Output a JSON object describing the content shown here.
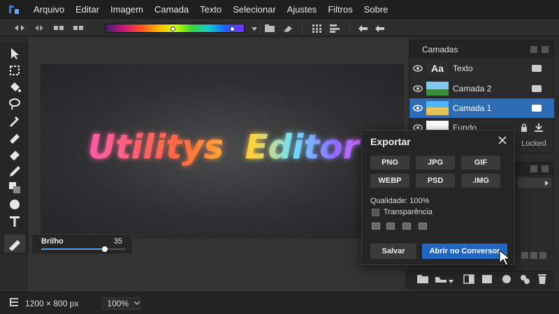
{
  "menu": {
    "items": [
      "Arquivo",
      "Editar",
      "Imagem",
      "Camada",
      "Texto",
      "Selecionar",
      "Ajustes",
      "Filtros",
      "Sobre"
    ]
  },
  "canvas": {
    "title_text_1": "Utilitys",
    "title_text_2": "Editor"
  },
  "brightness": {
    "label": "Brilho",
    "value": "35",
    "level": 0.76
  },
  "layers": {
    "title": "Camadas",
    "items": [
      {
        "name": "Texto",
        "thumb": "Aa"
      },
      {
        "name": "Camada 2"
      },
      {
        "name": "Camada 1"
      },
      {
        "name": "Fundo",
        "badge": "Locked"
      }
    ]
  },
  "export": {
    "title": "Exportar",
    "formats": [
      "PNG",
      "JPG",
      "GIF",
      "WEBP",
      "PSD",
      ".IMG"
    ],
    "quality_label": "Qualidade: 100%",
    "transparency_label": "Transparência",
    "save_label": "Salvar",
    "open_label": "Abrir no Conversor"
  },
  "status": {
    "dimensions": "1200 × 800 px",
    "zoom": "100%"
  },
  "colors": {
    "accent": "#2266c4",
    "selected_layer": "#2e6db4"
  }
}
